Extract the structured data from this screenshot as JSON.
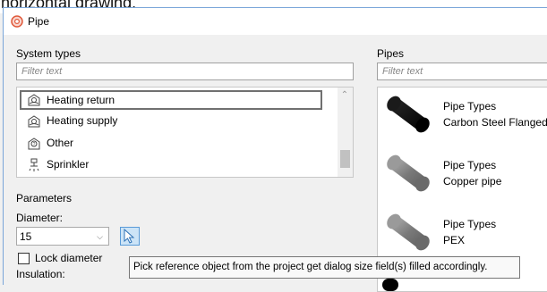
{
  "header_caption": "horizontal drawing.",
  "window": {
    "title": "Pipe",
    "title_icon": "pipe-app-icon"
  },
  "system_types": {
    "label": "System types",
    "filter_placeholder": "Filter text",
    "items": [
      {
        "label": "Heating return",
        "icon": "heating-return-icon",
        "selected": true
      },
      {
        "label": "Heating supply",
        "icon": "heating-supply-icon"
      },
      {
        "label": "Other",
        "icon": "other-icon"
      },
      {
        "label": "Sprinkler",
        "icon": "sprinkler-icon"
      }
    ]
  },
  "parameters": {
    "label": "Parameters",
    "diameter_label": "Diameter:",
    "diameter_value": "15",
    "lock_diameter_label": "Lock diameter",
    "insulation_label": "Insulation:"
  },
  "pipes": {
    "label": "Pipes",
    "filter_placeholder": "Filter text",
    "items": [
      {
        "type": "Pipe Types",
        "name": "Carbon Steel Flanged",
        "color": "#000000"
      },
      {
        "type": "Pipe Types",
        "name": "Copper pipe",
        "color": "#7d7d7d"
      },
      {
        "type": "Pipe Types",
        "name": "PEX",
        "color": "#7d7d7d"
      }
    ]
  },
  "tooltip": "Pick reference object from the project get dialog size field(s) filled accordingly."
}
